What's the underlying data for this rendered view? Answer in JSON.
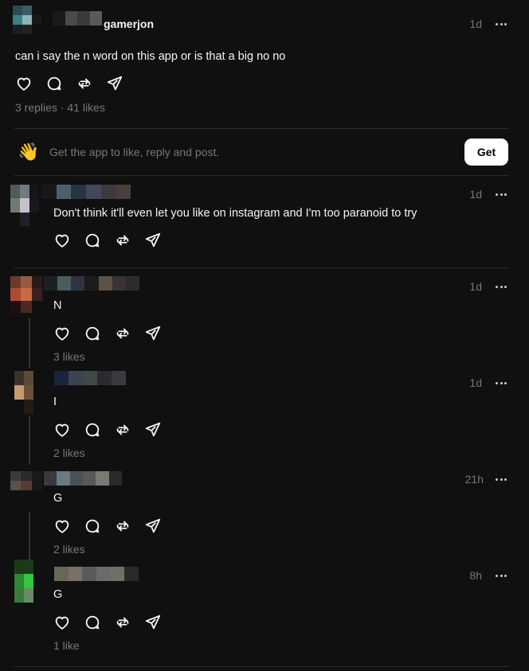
{
  "post": {
    "username": "gamerjon",
    "time": "1d",
    "text": "can i say the n word on this app or is that a big no no",
    "replies": "3 replies",
    "dot": "·",
    "likes": "41 likes"
  },
  "cta": {
    "emoji": "👋",
    "text": "Get the app to like, reply and post.",
    "button": "Get"
  },
  "replies": [
    {
      "time": "1d",
      "text": "Don't think it'll even let you like on instagram and I'm too paranoid to try",
      "likes": ""
    },
    {
      "time": "1d",
      "text": "N",
      "likes": "3 likes"
    },
    {
      "time": "1d",
      "text": "I",
      "likes": "2 likes"
    },
    {
      "time": "21h",
      "text": "G",
      "likes": "2 likes"
    },
    {
      "time": "8h",
      "text": "G",
      "likes": "1 like"
    }
  ],
  "icons": [
    "heart-icon",
    "comment-icon",
    "repost-icon",
    "share-icon",
    "more-icon"
  ]
}
